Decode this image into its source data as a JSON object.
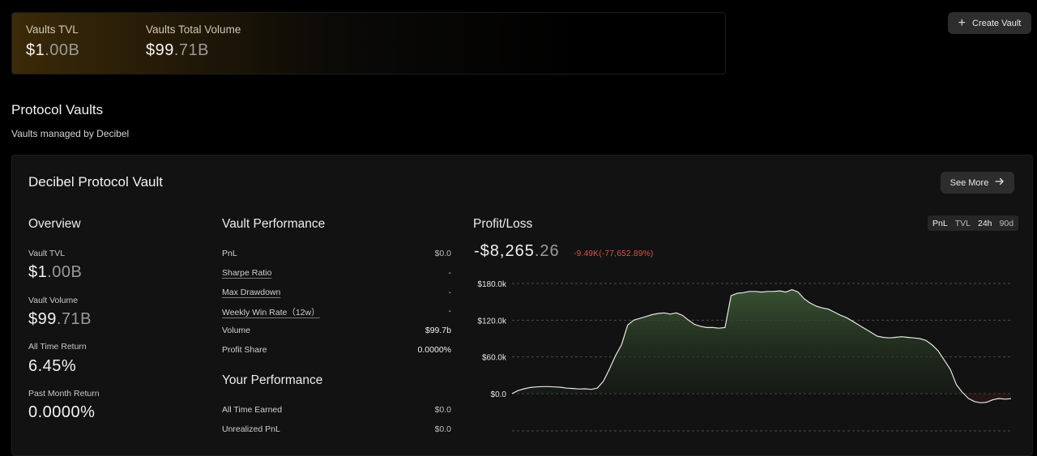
{
  "stats": {
    "tvl": {
      "label": "Vaults TVL",
      "value_main": "$1",
      "value_dim": ".00B"
    },
    "volume": {
      "label": "Vaults Total Volume",
      "value_main": "$99",
      "value_dim": ".71B"
    }
  },
  "create_vault": {
    "label": "Create Vault",
    "icon": "plus-icon"
  },
  "protocol": {
    "title": "Protocol Vaults",
    "subtitle": "Vaults managed by Decibel"
  },
  "vault": {
    "name": "Decibel Protocol Vault",
    "see_more": {
      "label": "See More",
      "icon": "arrow-right-icon"
    },
    "overview": {
      "title": "Overview",
      "items": [
        {
          "label": "Vault TVL",
          "value_main": "$1",
          "value_dim": ".00B"
        },
        {
          "label": "Vault Volume",
          "value_main": "$99",
          "value_dim": ".71B"
        },
        {
          "label": "All Time Return",
          "value_main": "6.45%",
          "value_dim": ""
        },
        {
          "label": "Past Month Return",
          "value_main": "0.0000%",
          "value_dim": ""
        }
      ]
    },
    "performance": {
      "title": "Vault Performance",
      "rows": [
        {
          "label": "PnL",
          "value": "$0.0"
        },
        {
          "label": "Sharpe Ratio",
          "value": "-"
        },
        {
          "label": "Max Drawdown",
          "value": "-"
        },
        {
          "label": "Weekly Win Rate（12w）",
          "value": "-"
        },
        {
          "label": "Volume",
          "value": "$99.7b"
        },
        {
          "label": "Profit Share",
          "value": "0.0000%"
        }
      ]
    },
    "your_performance": {
      "title": "Your Performance",
      "rows": [
        {
          "label": "All Time Earned",
          "value": "$0.0"
        },
        {
          "label": "Unrealized PnL",
          "value": "$0.0"
        }
      ]
    },
    "pnl": {
      "title": "Profit/Loss",
      "value_main": "-$8,265",
      "value_dim": ".26",
      "delta": "-9.49K(-77,652.89%)",
      "toggle_metric": {
        "options": [
          "PnL",
          "TVL"
        ],
        "active": "PnL"
      },
      "toggle_range": {
        "options": [
          "24h",
          "90d"
        ],
        "active": "24h"
      }
    }
  },
  "colors": {
    "accent_gold": "#3b2a08",
    "area_green": "#2f4a2a",
    "negative": "#e0524e",
    "line": "#e6e6e6"
  },
  "chart_data": {
    "type": "area",
    "title": "",
    "xlabel": "",
    "ylabel": "",
    "ylim": [
      -30000,
      185000
    ],
    "yticks": [
      "$180.0k",
      "$120.0k",
      "$60.0k",
      "$0.0"
    ],
    "ytick_values": [
      180000,
      120000,
      60000,
      0
    ],
    "grid": "dashed-horizontal",
    "series": [
      {
        "values": [
          0,
          5000,
          8000,
          10000,
          11000,
          11500,
          11500,
          11000,
          10500,
          9000,
          8500,
          7500,
          8000,
          7000,
          9000,
          20000,
          40000,
          62000,
          80000,
          112000,
          120000,
          123000,
          126000,
          129000,
          131000,
          132000,
          130000,
          132000,
          128000,
          120000,
          113000,
          110000,
          108000,
          108000,
          107000,
          108000,
          160000,
          164000,
          165000,
          167000,
          167000,
          166000,
          167000,
          167000,
          168000,
          166000,
          170000,
          166000,
          155000,
          148000,
          143000,
          140000,
          138000,
          133000,
          128000,
          124000,
          118000,
          112000,
          106000,
          100000,
          94000,
          92000,
          91000,
          92000,
          93000,
          92000,
          91000,
          90000,
          87000,
          80000,
          70000,
          55000,
          40000,
          15000,
          2000,
          -8000,
          -13000,
          -15000,
          -14000,
          -10000,
          -8000,
          -9000,
          -8265
        ]
      }
    ]
  }
}
